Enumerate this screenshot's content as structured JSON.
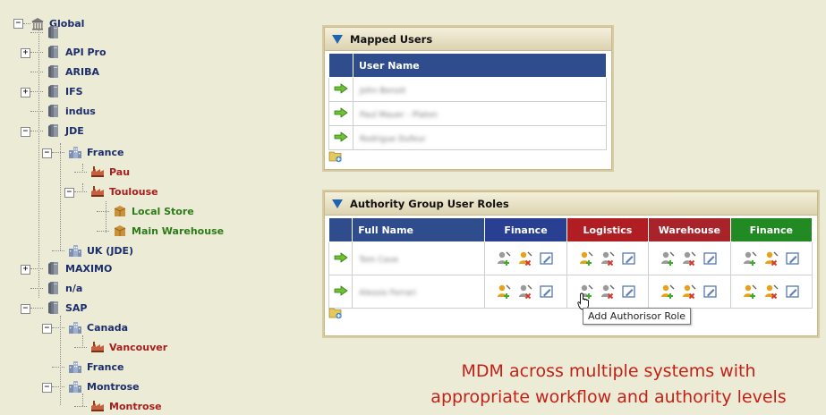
{
  "tree": {
    "root": {
      "label": "Global",
      "icon": "globe-building-icon"
    },
    "nodes": [
      {
        "label": "",
        "type": "system"
      },
      {
        "label": "API Pro",
        "type": "system"
      },
      {
        "label": "ARIBA",
        "type": "system"
      },
      {
        "label": "IFS",
        "type": "system"
      },
      {
        "label": "indus",
        "type": "system"
      },
      {
        "label": "JDE",
        "type": "system"
      },
      {
        "label": "France",
        "type": "country"
      },
      {
        "label": "Pau",
        "type": "site"
      },
      {
        "label": "Toulouse",
        "type": "site"
      },
      {
        "label": "Local Store",
        "type": "store"
      },
      {
        "label": "Main Warehouse",
        "type": "store"
      },
      {
        "label": "UK (JDE)",
        "type": "country"
      },
      {
        "label": "MAXIMO",
        "type": "system"
      },
      {
        "label": "n/a",
        "type": "system"
      },
      {
        "label": "SAP",
        "type": "system"
      },
      {
        "label": "Canada",
        "type": "country"
      },
      {
        "label": "Vancouver",
        "type": "site"
      },
      {
        "label": "France",
        "type": "country"
      },
      {
        "label": "Montrose",
        "type": "country"
      },
      {
        "label": "Montrose",
        "type": "site"
      }
    ]
  },
  "mapped_users": {
    "title": "Mapped Users",
    "column": "User Name",
    "rows": [
      "John Benoit",
      "Paul Mauer - Platon",
      "Rodrigue Dufeur"
    ]
  },
  "authority": {
    "title": "Authority Group User Roles",
    "name_column": "Full Name",
    "groups": [
      {
        "label": "Finance",
        "color": "#283f92"
      },
      {
        "label": "Logistics",
        "color": "#b01e23"
      },
      {
        "label": "Warehouse",
        "color": "#a9232a"
      },
      {
        "label": "Finance",
        "color": "#218a22"
      }
    ],
    "rows": [
      "Tom Cave",
      "Alessio Ferrari"
    ]
  },
  "tooltip": "Add Authorisor Role",
  "caption": {
    "line1": "MDM across multiple systems with",
    "line2": "appropriate workflow and authority levels"
  },
  "colors": {
    "header_blue": "#2f4d8c",
    "caption_red": "#c32118",
    "background": "#ecebd6"
  }
}
